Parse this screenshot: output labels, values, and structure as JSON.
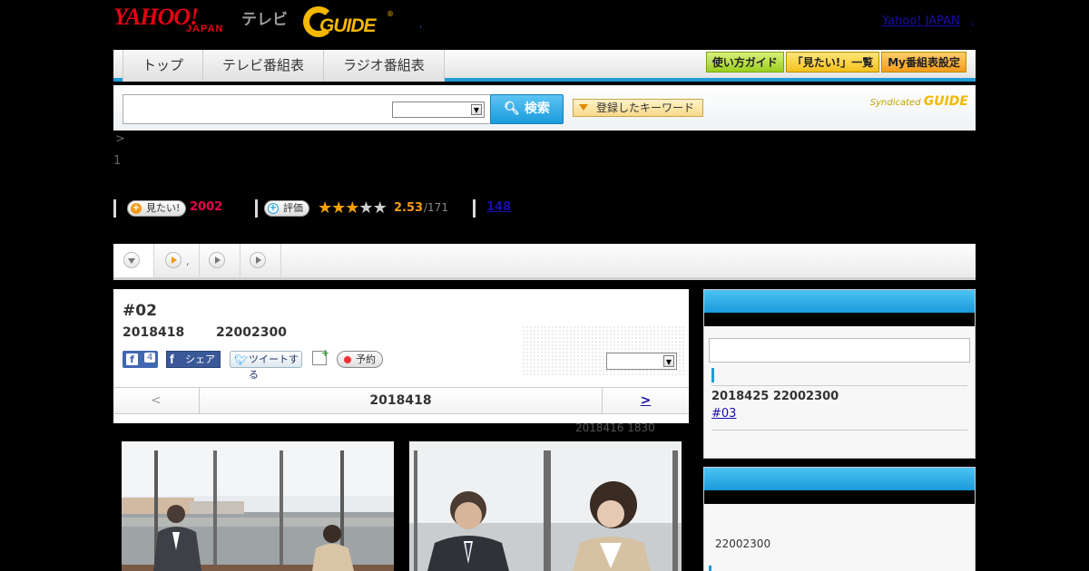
{
  "header": {
    "logo_yahoo": "YAHOO!",
    "logo_japan": "JAPAN",
    "logo_tv": "テレビ",
    "logo_gguide": "GUIDE",
    "logo_reg": "®",
    "dot": ",",
    "yahoo_japan_link": "Yahoo! JAPAN",
    "yahoo_japan_dot": ","
  },
  "nav": {
    "tabs": [
      {
        "label": "トップ"
      },
      {
        "label": "テレビ番組表"
      },
      {
        "label": "ラジオ番組表"
      }
    ],
    "buttons": {
      "guide": "使い方ガイド",
      "want_list": "「見たい!」一覧",
      "my_schedule": "My番組表設定"
    }
  },
  "search": {
    "placeholder": "",
    "button": "検索",
    "keyword_button": "登録したキーワード",
    "syndicated": "Syndicated",
    "syndicated_logo": "GUIDE"
  },
  "breadcrumb": ">",
  "small_number": "1",
  "stats": {
    "want_label": "見たい!",
    "want_count": "2002",
    "rate_label": "評価",
    "rating": 2.53,
    "score": "2.53",
    "score_den": "/171",
    "review_count": "148"
  },
  "tabstrip": {
    "dot": ","
  },
  "episode": {
    "title": "#02",
    "date": "2018418",
    "time": "22002300",
    "fb_like_count": "4",
    "fb_share": "シェア",
    "tweet": "ツイートする",
    "reserve": "予約",
    "nav_prev": "<",
    "nav_date": "2018418",
    "nav_next": ">",
    "updated": "2018416  1830"
  },
  "sidebar": {
    "next_info": "2018425  22002300",
    "next_link": "#03",
    "time2": "22002300"
  },
  "colors": {
    "accent": "#1f9bd6",
    "want_red": "#e6004b",
    "score_orange": "#f39b1a"
  }
}
